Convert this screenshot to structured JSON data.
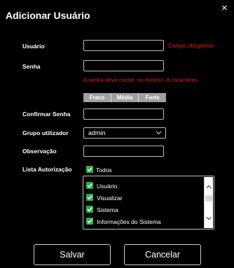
{
  "dialog": {
    "title": "Adicionar Usuário",
    "close_glyph": "×"
  },
  "form": {
    "usuario": {
      "label": "Usuário",
      "value": "",
      "error": "Campo obrigatório"
    },
    "senha": {
      "label": "Senha",
      "value": "",
      "hint": "A senha deve conter, no mínimo, 8 caracteres."
    },
    "strength": [
      "Fraco",
      "Média",
      "Forte"
    ],
    "confirmar_senha": {
      "label": "Confirmar Senha",
      "value": ""
    },
    "grupo": {
      "label": "Grupo utilizador",
      "selected": "admin"
    },
    "observacao": {
      "label": "Observação",
      "value": ""
    },
    "lista": {
      "label": "Lista Autorização",
      "todos_label": "Todos",
      "todos_checked": true,
      "items": [
        {
          "label": "Usuário",
          "checked": true
        },
        {
          "label": "Visualizar",
          "checked": true
        },
        {
          "label": "Sistema",
          "checked": true
        },
        {
          "label": "Informações do Sistema",
          "checked": true
        }
      ]
    }
  },
  "buttons": {
    "save": "Salvar",
    "cancel": "Cancelar"
  },
  "colors": {
    "background": "#000000",
    "error": "#e31c1c",
    "checkbox": "#2fae4a",
    "strength_bar": "#a0a0a0"
  }
}
